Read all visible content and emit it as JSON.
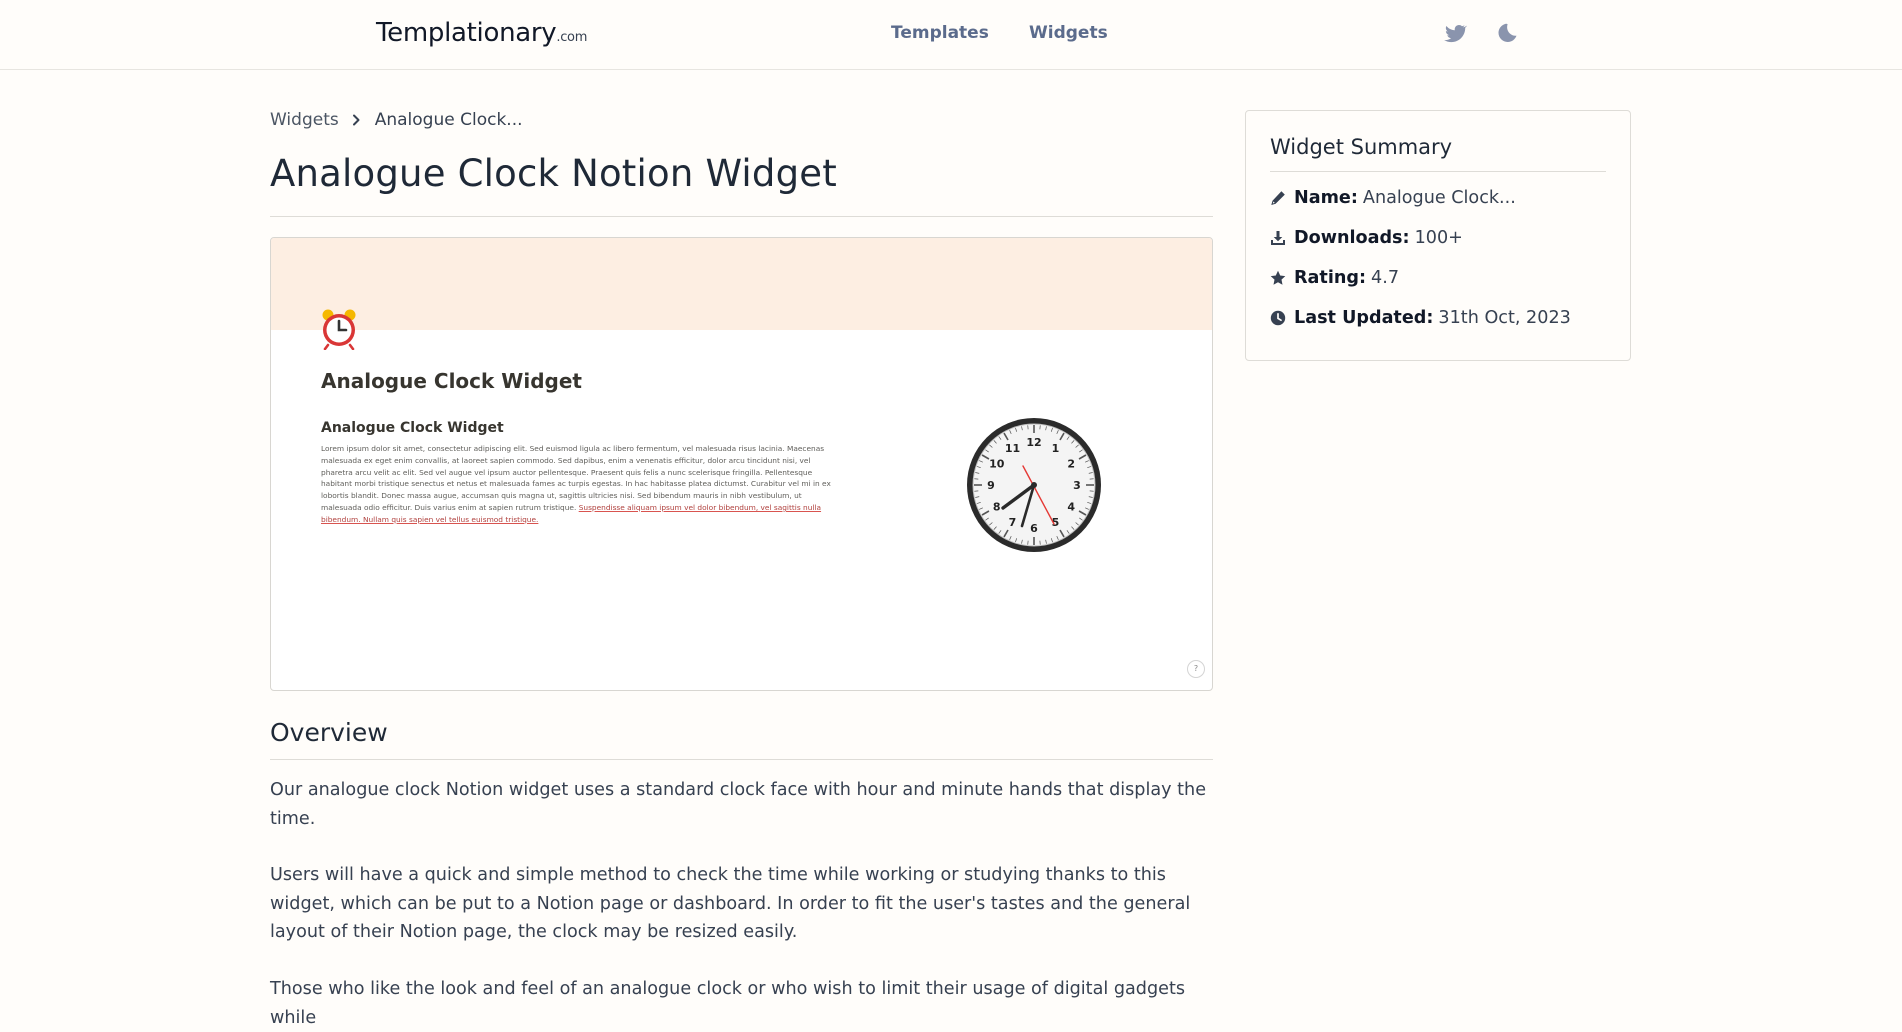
{
  "header": {
    "logo_main": "Templationary",
    "logo_suffix": ".com",
    "nav": {
      "templates": "Templates",
      "widgets": "Widgets"
    },
    "icons": [
      "twitter-icon",
      "moon-icon"
    ]
  },
  "breadcrumb": {
    "parent": "Widgets",
    "current": "Analogue Clock..."
  },
  "page": {
    "title": "Analogue Clock Notion Widget"
  },
  "preview": {
    "heading": "Analogue Clock Widget",
    "subheading": "Analogue Clock Widget",
    "body_text": "Lorem ipsum dolor sit amet, consectetur adipiscing elit. Sed euismod ligula ac libero fermentum, vel malesuada risus lacinia. Maecenas malesuada ex eget enim convallis, at laoreet sapien commodo. Sed dapibus, enim a venenatis efficitur, dolor arcu tincidunt nisi, vel pharetra arcu velit ac elit. Sed vel augue vel ipsum auctor pellentesque. Praesent quis felis a nunc scelerisque fringilla. Pellentesque habitant morbi tristique senectus et netus et malesuada fames ac turpis egestas. In hac habitasse platea dictumst. Curabitur vel mi in ex lobortis blandit. Donec massa augue, accumsan quis magna ut, sagittis ultricies nisi. Sed bibendum mauris in nibh vestibulum, ut malesuada odio efficitur. Duis varius enim at sapien rutrum tristique.",
    "body_links": "Suspendisse aliquam ipsum vel dolor bibendum, vel sagittis nulla bibendum. Nullam quis sapien vel tellus euismod tristique.",
    "clock_numbers": [
      "12",
      "1",
      "2",
      "3",
      "4",
      "5",
      "6",
      "7",
      "8",
      "9",
      "10",
      "11"
    ],
    "help_label": "?",
    "accent_banner": "#fdeee2",
    "accent_second_hand": "#e53935"
  },
  "overview": {
    "title": "Overview",
    "paragraphs": [
      "Our analogue clock Notion widget uses a standard clock face with hour and minute hands that display the time.",
      "Users will have a quick and simple method to check the time while working or studying thanks to this widget, which can be put to a Notion page or dashboard. In order to fit the user's tastes and the general layout of their Notion page, the clock may be resized easily.",
      "Those who like the look and feel of an analogue clock or who wish to limit their usage of digital gadgets while"
    ]
  },
  "summary": {
    "title": "Widget Summary",
    "rows": [
      {
        "icon": "pencil-icon",
        "label": "Name:",
        "value": "Analogue Clock..."
      },
      {
        "icon": "download-icon",
        "label": "Downloads:",
        "value": "100+"
      },
      {
        "icon": "star-icon",
        "label": "Rating:",
        "value": "4.7"
      },
      {
        "icon": "clock-icon",
        "label": "Last Updated:",
        "value": "31th Oct, 2023"
      }
    ]
  }
}
